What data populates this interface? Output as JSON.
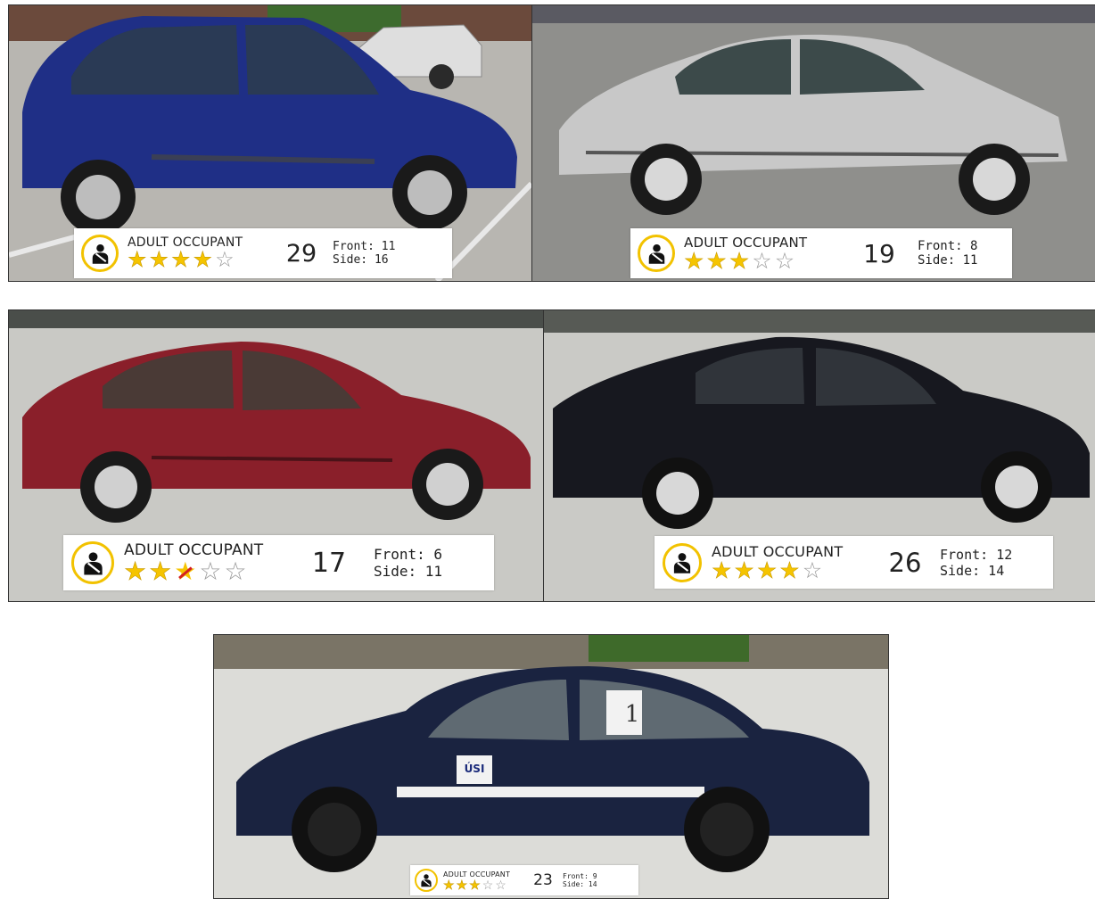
{
  "rating_category": "ADULT OCCUPANT",
  "front_prefix": "Front:",
  "side_prefix": "Side:",
  "colors": {
    "star_filled": "#f5c400",
    "star_empty": "#9a9a9a",
    "icon_ring": "#f2c200",
    "car_blue_minivan": "#1f2f86",
    "car_silver": "#c8c8c8",
    "car_red": "#8a1f2a",
    "car_black": "#17181f",
    "car_navy": "#1a2340"
  },
  "cars": [
    {
      "score": "29",
      "front": "11",
      "side": "16",
      "stars": {
        "filled": 4,
        "empty": 1,
        "crossed": 0
      }
    },
    {
      "score": "19",
      "front": "8",
      "side": "11",
      "stars": {
        "filled": 3,
        "empty": 2,
        "crossed": 0
      }
    },
    {
      "score": "17",
      "front": "6",
      "side": "11",
      "stars": {
        "filled": 2,
        "empty": 2,
        "crossed": 1
      }
    },
    {
      "score": "26",
      "front": "12",
      "side": "14",
      "stars": {
        "filled": 4,
        "empty": 1,
        "crossed": 0
      }
    },
    {
      "score": "23",
      "front": "9",
      "side": "14",
      "stars": {
        "filled": 3,
        "empty": 2,
        "crossed": 0
      }
    }
  ],
  "photo5": {
    "door_sign": "1",
    "logo": "ÚSI"
  }
}
